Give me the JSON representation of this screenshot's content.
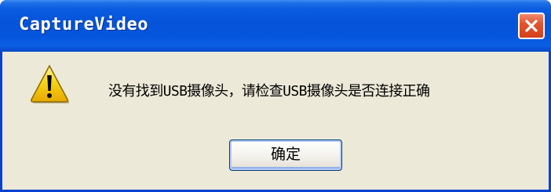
{
  "window": {
    "title": "CaptureVideo"
  },
  "titlebar": {
    "close_icon": "close-icon"
  },
  "dialog": {
    "icon": "warning-icon",
    "message": "没有找到USB摄像头，请检查USB摄像头是否连接正确",
    "ok_label": "确定"
  },
  "colors": {
    "titlebar": "#0553d8",
    "client_background": "#ece9d8",
    "close_button": "#e2552f",
    "warning_fill": "#f7d417"
  }
}
